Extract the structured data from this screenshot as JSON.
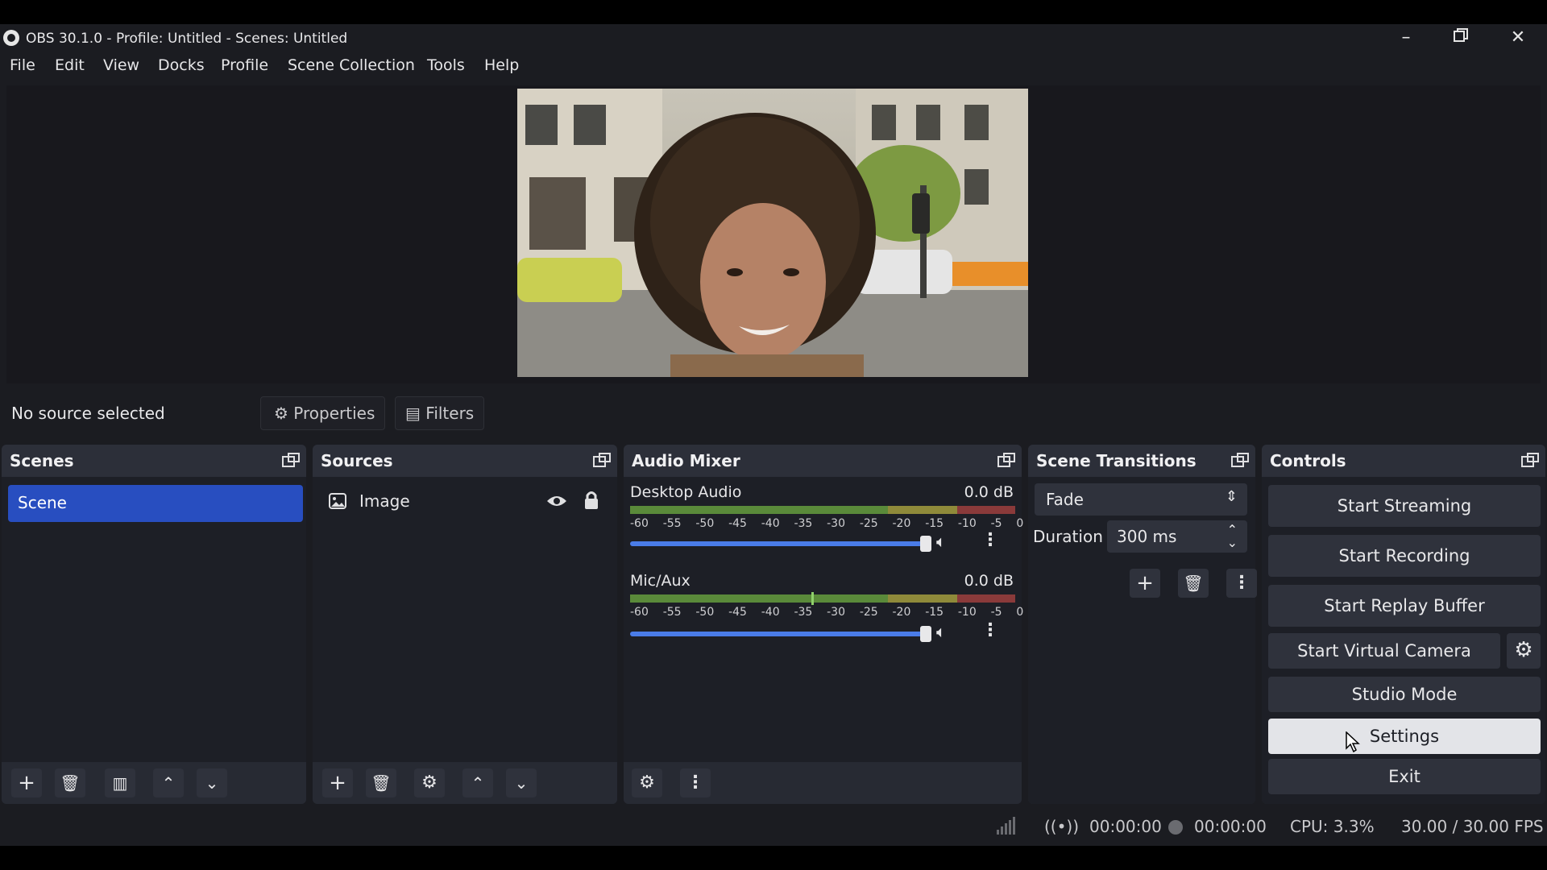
{
  "window": {
    "title": "OBS 30.1.0 - Profile: Untitled - Scenes: Untitled"
  },
  "menu": [
    "File",
    "Edit",
    "View",
    "Docks",
    "Profile",
    "Scene Collection",
    "Tools",
    "Help"
  ],
  "source_toolbar": {
    "status": "No source selected",
    "properties_label": "Properties",
    "filters_label": "Filters"
  },
  "scenes": {
    "title": "Scenes",
    "items": [
      "Scene"
    ]
  },
  "sources": {
    "title": "Sources",
    "items": [
      {
        "name": "Image",
        "visible": true,
        "locked": true
      }
    ]
  },
  "audio_mixer": {
    "title": "Audio Mixer",
    "tracks": [
      {
        "name": "Desktop Audio",
        "db": "0.0 dB",
        "volume": 1.0
      },
      {
        "name": "Mic/Aux",
        "db": "0.0 dB",
        "volume": 1.0
      }
    ],
    "scale": [
      "-60",
      "-55",
      "-50",
      "-45",
      "-40",
      "-35",
      "-30",
      "-25",
      "-20",
      "-15",
      "-10",
      "-5",
      "0"
    ]
  },
  "scene_transitions": {
    "title": "Scene Transitions",
    "transition": "Fade",
    "duration_label": "Duration",
    "duration_value": "300 ms"
  },
  "controls": {
    "title": "Controls",
    "start_streaming": "Start Streaming",
    "start_recording": "Start Recording",
    "start_replay_buffer": "Start Replay Buffer",
    "start_virtual_camera": "Start Virtual Camera",
    "studio_mode": "Studio Mode",
    "settings": "Settings",
    "exit": "Exit"
  },
  "status": {
    "stream_time": "00:00:00",
    "record_time": "00:00:00",
    "cpu": "CPU: 3.3%",
    "fps": "30.00 / 30.00 FPS"
  },
  "colors": {
    "accent": "#284ec0",
    "slider": "#4a7ce8",
    "meter_green": "#5a8a3a",
    "meter_yellow": "#8f8a3a",
    "meter_red": "#8a3a3a"
  }
}
